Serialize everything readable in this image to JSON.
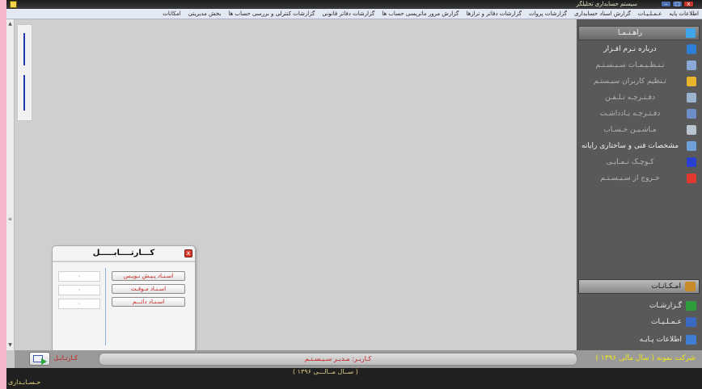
{
  "window": {
    "title": "سیستم حسابداری تحلیلگر",
    "controls": {
      "minimize": "–",
      "maximize": "□",
      "close": "x"
    }
  },
  "menu": [
    "اطلاعات پایه",
    "عـمـلـیـات",
    "گزارش اسناد حسابداری",
    "گزارشات پروات",
    "گزارشات دفاتر و ترازها",
    "گزارش مرور ماتریسی حساب ها",
    "گزارشات دفاتر قانونی",
    "گزارشات کنترلی و بررسی حساب ها",
    "بخش مدیریتی",
    "امکانات"
  ],
  "sidebar": {
    "items": [
      {
        "label": "راهـنـمـا",
        "icon": "help-icon",
        "color": "#3fa4e8"
      },
      {
        "label": "درباره نـرم افـزار",
        "icon": "info-icon",
        "color": "#2c7fd6"
      },
      {
        "label": "تـنـظـیـمـات سـیـسـتـم",
        "icon": "tools-icon",
        "color": "#8aa8d8"
      },
      {
        "label": "تـنظیم کاربران سیـستـم",
        "icon": "users-icon",
        "color": "#e6b52c"
      },
      {
        "label": "دفـتـرچـه تـلـفـن",
        "icon": "phonebook-icon",
        "color": "#9bb3cf"
      },
      {
        "label": "دفـتـرچـه یـادداشـت",
        "icon": "notebook-icon",
        "color": "#6d8fc9"
      },
      {
        "label": "مـاشـیـن حـسـاب",
        "icon": "calculator-icon",
        "color": "#b8c4cf"
      },
      {
        "label": "مشخصات فنی و ساختاری رایانه",
        "icon": "computer-icon",
        "color": "#6fa0d8"
      },
      {
        "label": "کـوچـک نـمـایـی",
        "icon": "minimize-icon",
        "color": "#2b3fd0"
      },
      {
        "label": "خـروج از سـیـسـتـم",
        "icon": "exit-icon",
        "color": "#e03a30"
      }
    ],
    "nav": [
      {
        "label": "امـکـانـات",
        "icon": "facilities-icon",
        "color": "#c98a2a"
      },
      {
        "label": "گـزارشـات",
        "icon": "reports-icon",
        "color": "#2f9d3c"
      },
      {
        "label": "عـمـلـیـات",
        "icon": "operations-icon",
        "color": "#3b68c2"
      },
      {
        "label": "اطلاعات پـایـه",
        "icon": "base-info-icon",
        "color": "#3f7ed2"
      }
    ]
  },
  "kartabl": {
    "title": "کـــارتــــابـــــل",
    "close": "x",
    "buttons": [
      "اسـنـاد پـیـش نـویـس",
      "اسـنـاد مـوقـت",
      "اسـنـاد دائـــم"
    ],
    "values": [
      "۰",
      "۰",
      "۰"
    ]
  },
  "status": {
    "user": "کـاربـر: مـدیـر سـیـسـتـم",
    "company": "شرکت نمونه ( سال مالی ۱۳۹۶ )",
    "kartabl_label": "کـارتـابـل"
  },
  "footer": {
    "year": "( ســال مــالـــی ۱۳۹۶ )",
    "app": "حـسـابـداری"
  }
}
